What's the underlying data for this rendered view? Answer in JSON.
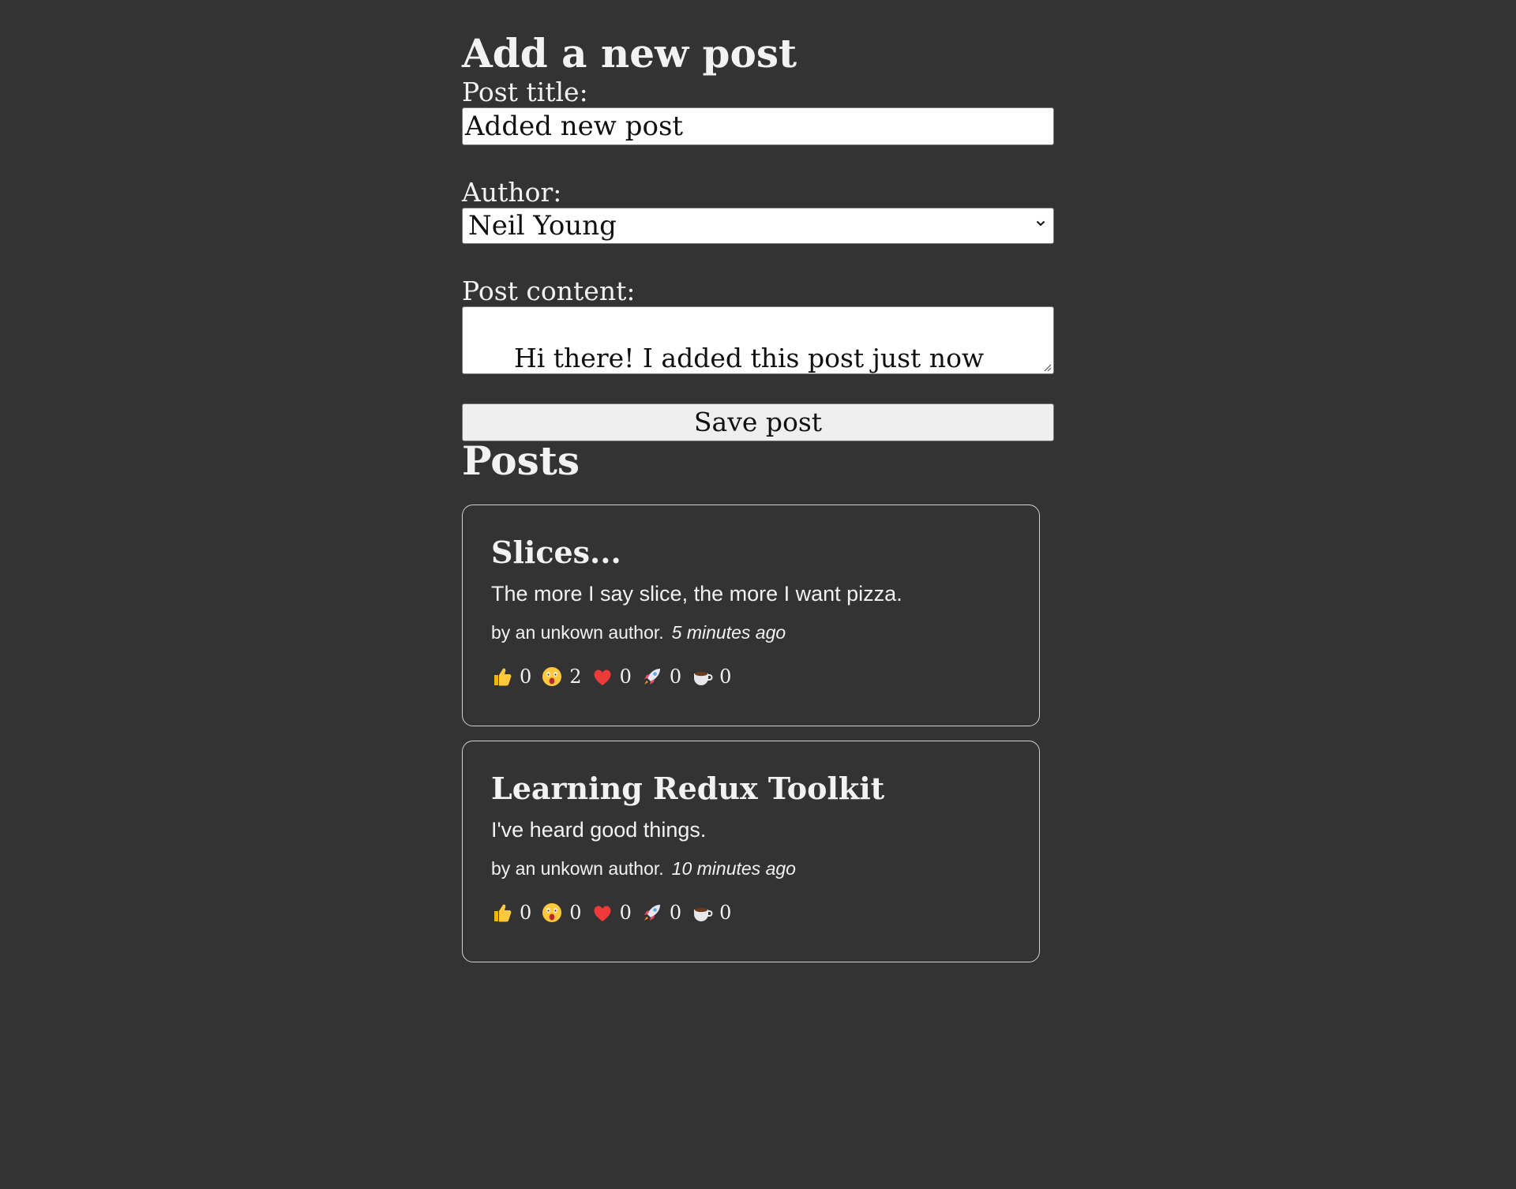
{
  "form": {
    "heading": "Add a new post",
    "title_label": "Post title:",
    "title_value": "Added new post",
    "author_label": "Author:",
    "author_selected": "Neil Young",
    "content_label": "Post content:",
    "content_value": "Hi there! I added this post just now using the 'save post' button.",
    "save_label": "Save post"
  },
  "posts_section": {
    "heading": "Posts",
    "posts": [
      {
        "title": "Slices...",
        "excerpt": "The more I say slice, the more I want pizza.",
        "author": "by an unkown author.",
        "time_ago": "5 minutes ago",
        "reactions": [
          {
            "icon": "thumbs-up-icon",
            "count": "0"
          },
          {
            "icon": "wow-face-icon",
            "count": "2"
          },
          {
            "icon": "heart-icon",
            "count": "0"
          },
          {
            "icon": "rocket-icon",
            "count": "0"
          },
          {
            "icon": "coffee-icon",
            "count": "0"
          }
        ]
      },
      {
        "title": "Learning Redux Toolkit",
        "excerpt": "I've heard good things.",
        "author": "by an unkown author.",
        "time_ago": "10 minutes ago",
        "reactions": [
          {
            "icon": "thumbs-up-icon",
            "count": "0"
          },
          {
            "icon": "wow-face-icon",
            "count": "0"
          },
          {
            "icon": "heart-icon",
            "count": "0"
          },
          {
            "icon": "rocket-icon",
            "count": "0"
          },
          {
            "icon": "coffee-icon",
            "count": "0"
          }
        ]
      }
    ]
  },
  "colors": {
    "background": "#333333",
    "text": "#f2f2f2",
    "card_border": "#d0d0d0"
  }
}
